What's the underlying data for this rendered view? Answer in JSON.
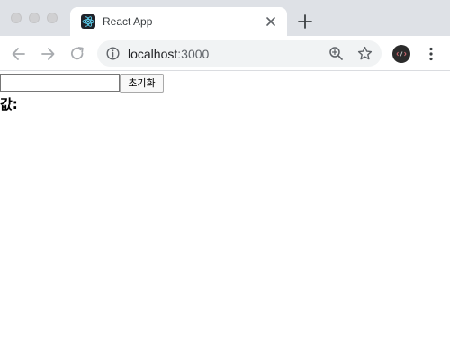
{
  "browser": {
    "tab": {
      "title": "React App"
    },
    "address": {
      "host": "localhost",
      "port": ":3000"
    }
  },
  "page": {
    "input": {
      "value": "",
      "placeholder": ""
    },
    "reset_button_label": "초기화",
    "value_label": "값:"
  },
  "icons": {
    "favicon": "react-logo-icon",
    "close": "close-icon",
    "new_tab": "plus-icon",
    "back": "arrow-left-icon",
    "forward": "arrow-right-icon",
    "reload": "reload-icon",
    "info": "info-icon",
    "zoom": "zoom-in-icon",
    "bookmark": "star-icon",
    "extension": "extension-avatar-icon",
    "menu": "more-vertical-icon"
  },
  "colors": {
    "tabstrip": "#dee1e6",
    "omnibox": "#f1f3f4",
    "react_blue": "#61dafb"
  }
}
